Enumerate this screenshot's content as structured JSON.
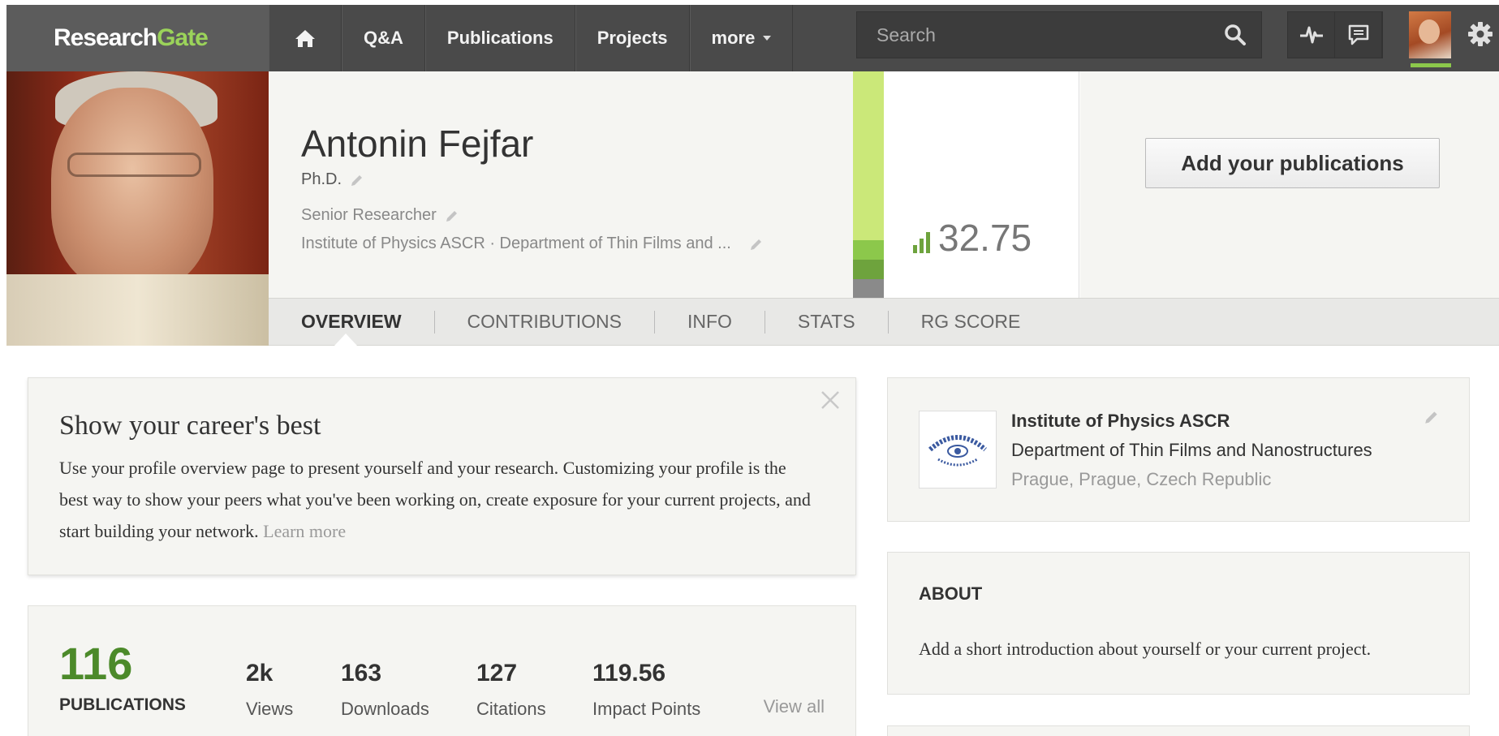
{
  "topbar": {
    "logo_part1": "Research",
    "logo_part2": "Gate",
    "nav": [
      "Q&A",
      "Publications",
      "Projects"
    ],
    "more_label": "more",
    "search_placeholder": "Search",
    "icons": [
      "home-icon",
      "search-icon",
      "activity-icon",
      "messages-icon",
      "settings-icon"
    ],
    "accent_color": "#8cc84b"
  },
  "profile": {
    "name": "Antonin Fejfar",
    "degree": "Ph.D.",
    "position": "Senior Researcher",
    "institution_line": "Institute of Physics ASCR · Department of Thin Films and ...",
    "rg_score": "32.75",
    "add_publications_label": "Add your publications"
  },
  "tabs": [
    "OVERVIEW",
    "CONTRIBUTIONS",
    "INFO",
    "STATS",
    "RG SCORE"
  ],
  "career_card": {
    "title": "Show your career's best",
    "text": "Use your profile overview page to present yourself and your research. Customizing your profile is the best way to show your peers what you've been working on, create exposure for your current projects, and start building your network.",
    "learn_more": "Learn more"
  },
  "stats": {
    "publications_count": "116",
    "publications_label": "PUBLICATIONS",
    "items": [
      {
        "value": "2k",
        "label": "Views"
      },
      {
        "value": "163",
        "label": "Downloads"
      },
      {
        "value": "127",
        "label": "Citations"
      },
      {
        "value": "119.56",
        "label": "Impact Points"
      }
    ],
    "view_all": "View all"
  },
  "institution": {
    "name": "Institute of Physics ASCR",
    "department": "Department of Thin Films and Nanostructures",
    "location": "Prague, Prague, Czech Republic"
  },
  "about": {
    "title": "ABOUT",
    "text": "Add a short introduction about yourself or your current project."
  }
}
